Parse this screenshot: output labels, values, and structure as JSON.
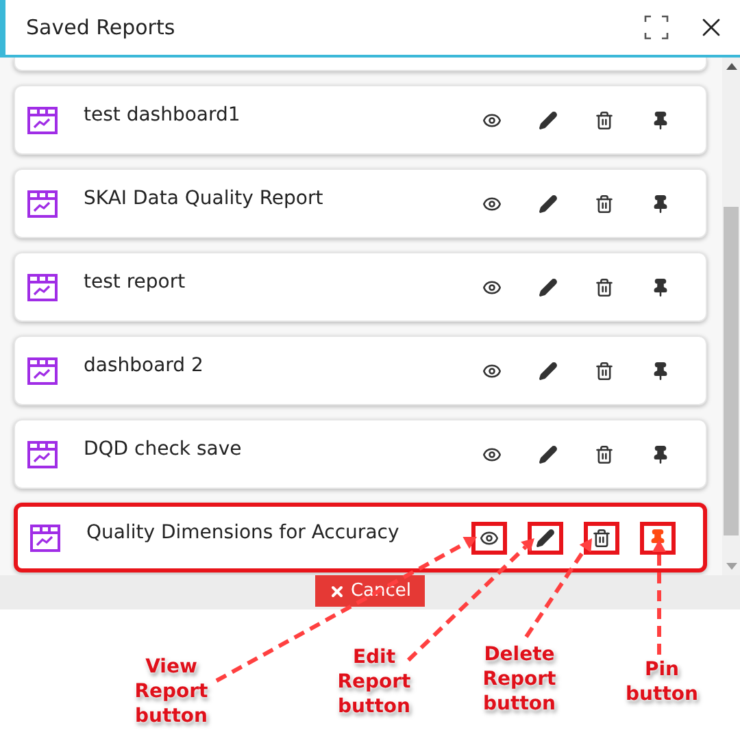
{
  "dialog": {
    "title": "Saved Reports"
  },
  "reports": [
    {
      "name": "test dashboard1",
      "pinned": false,
      "highlighted": false
    },
    {
      "name": "SKAI Data Quality Report",
      "pinned": false,
      "highlighted": false
    },
    {
      "name": "test report",
      "pinned": false,
      "highlighted": false
    },
    {
      "name": "dashboard 2",
      "pinned": false,
      "highlighted": false
    },
    {
      "name": "DQD check save",
      "pinned": false,
      "highlighted": false
    },
    {
      "name": "Quality Dimensions for Accuracy",
      "pinned": true,
      "highlighted": true
    }
  ],
  "cancel_button": {
    "label": "Cancel"
  },
  "callouts": [
    {
      "text": "View Report button",
      "kind": "view"
    },
    {
      "text": "Edit Report button",
      "kind": "edit"
    },
    {
      "text": "Delete Report button",
      "kind": "delete"
    },
    {
      "text": "Pin button",
      "kind": "pin"
    }
  ]
}
